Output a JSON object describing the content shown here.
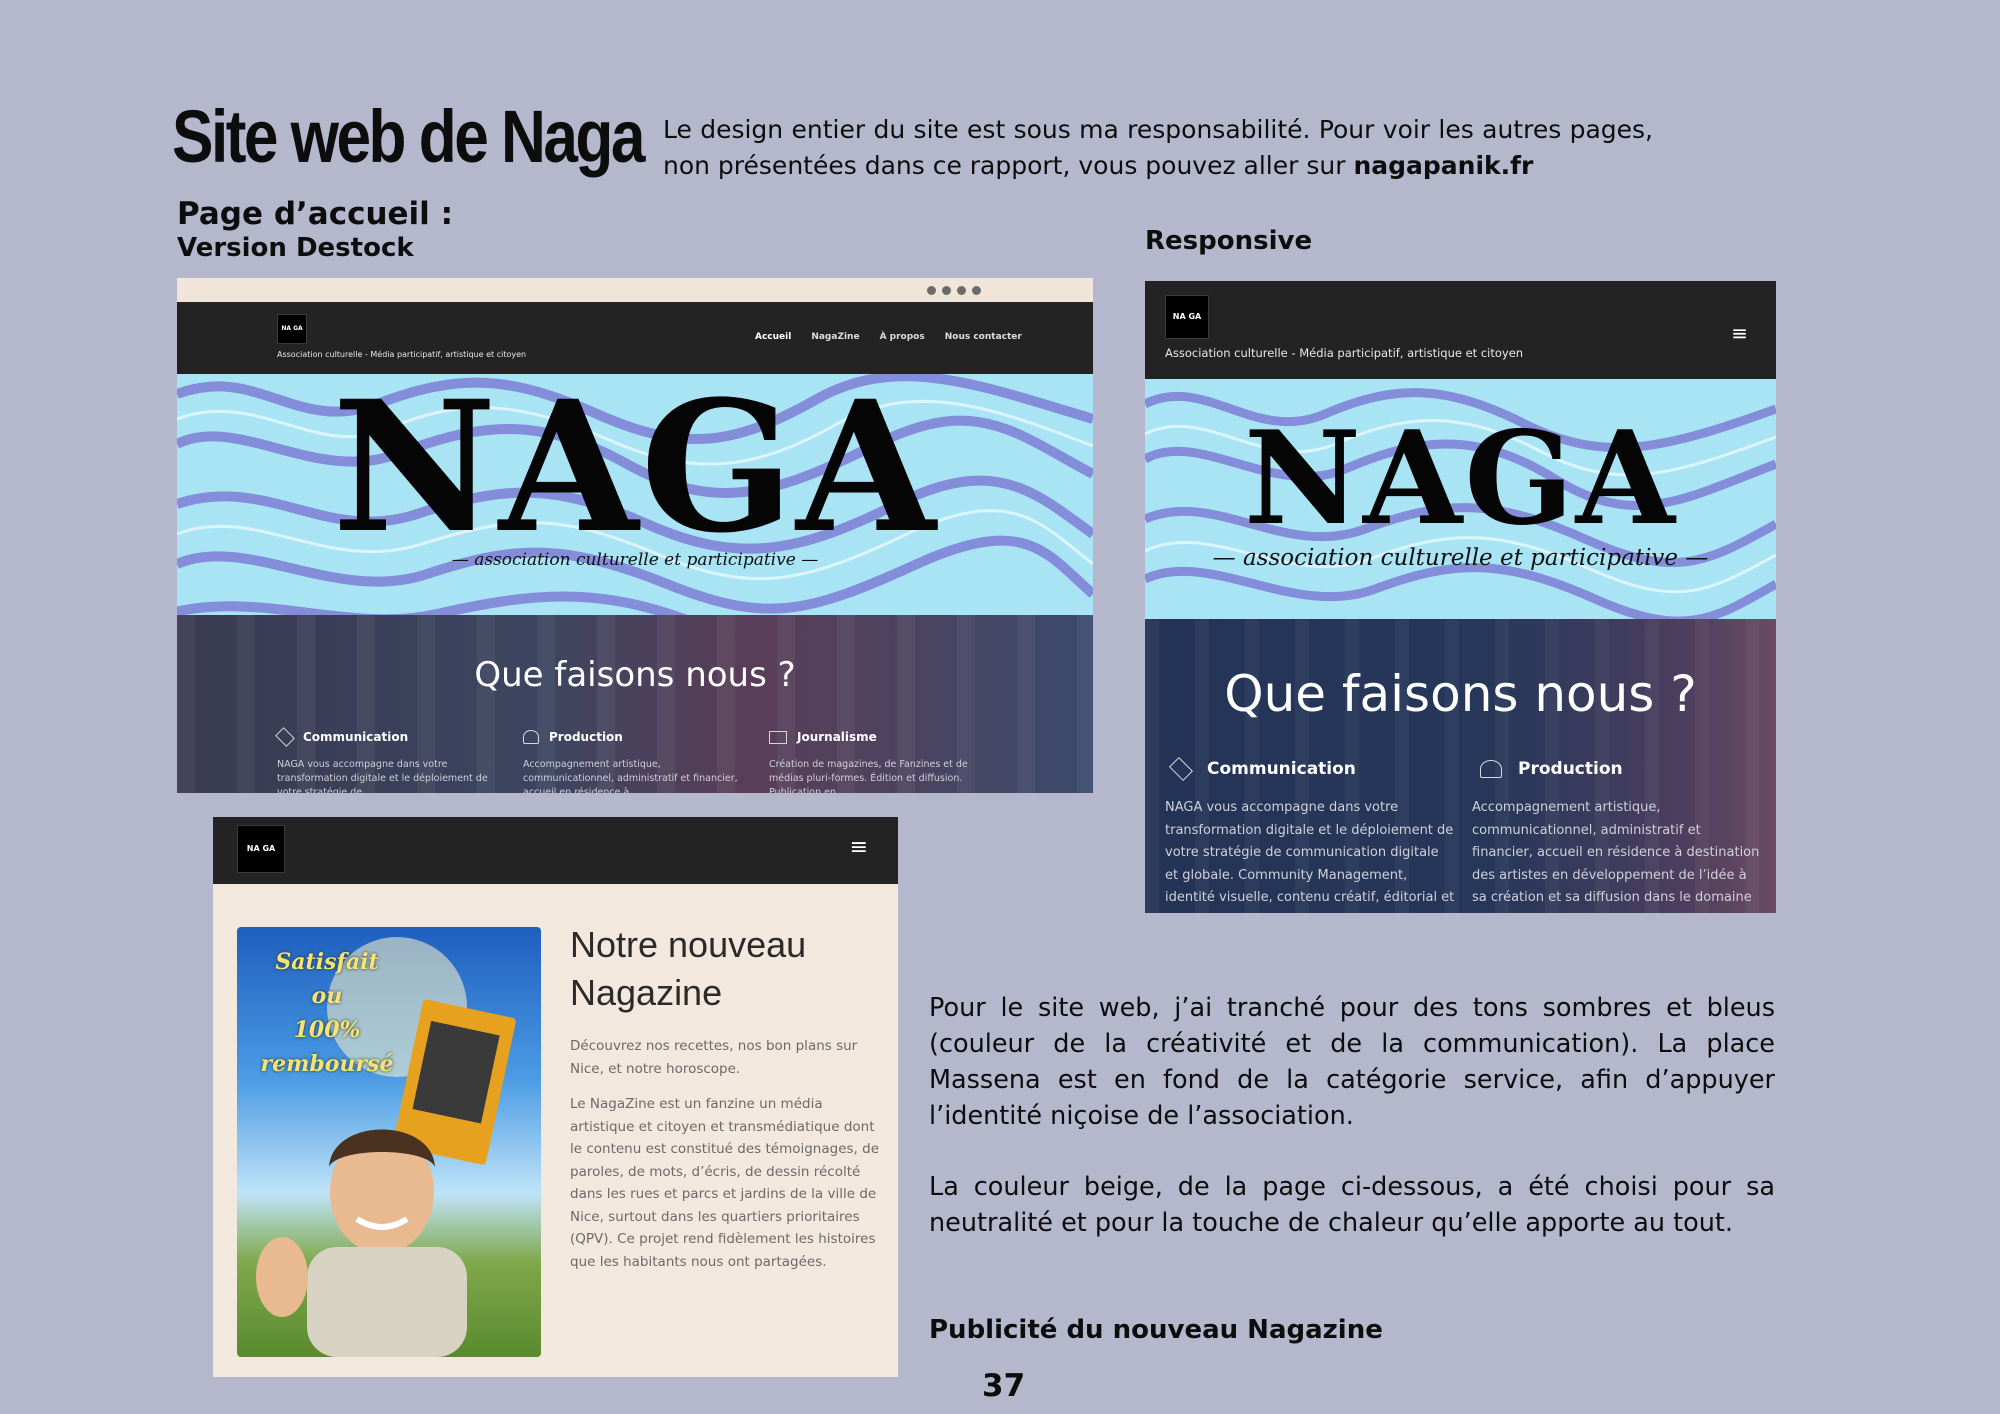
{
  "page": {
    "title": "Site web de Naga",
    "intro_text": "Le design entier du site est sous ma responsabilité. Pour voir les autres pages, non présentées dans ce rapport, vous pouvez aller sur",
    "intro_link": "nagapanik.fr",
    "section_home": "Page d’accueil :",
    "section_desktop": "Version Destock",
    "section_responsive": "Responsive",
    "body_p1": "Pour le site web, j’ai tranché pour des tons sombres et bleus (couleur de la créativité et de la communication). La place Massena est en fond de la catégorie service, afin d’appuyer l’identité niçoise de l’association.",
    "body_p2": "La couleur beige, de la page ci-dessous, a été choisi pour sa neutralité et pour la touche de chaleur qu’elle apporte au tout.",
    "section_ad": "Publicité du nouveau Nagazine",
    "page_number": "37"
  },
  "site": {
    "logo_text": "NA GA",
    "tagline": "Association culturelle - Média participatif, artistique et citoyen",
    "nav": [
      "Accueil",
      "NagaZine",
      "À propos",
      "Nous contacter"
    ],
    "hero_word": "NAGA",
    "hero_sub": "association culturelle et participative",
    "services_title": "Que faisons nous ?",
    "services": [
      {
        "icon": "handshake-icon",
        "title": "Communication",
        "desc_desktop": "NAGA vous accompagne dans votre transformation digitale et le déploiement de votre stratégie de",
        "desc_mobile": "NAGA vous accompagne dans votre transformation digitale et le déploiement de votre stratégie de communication digitale et globale. Community Management, identité visuelle, contenu créatif, éditorial et viral…"
      },
      {
        "icon": "video-camera-icon",
        "title": "Production",
        "desc_desktop": "Accompagnement artistique, communicationnel, administratif et financier, accueil en résidence à",
        "desc_mobile": "Accompagnement artistique, communicationnel, administratif et financier, accueil en résidence à destination des artistes en développement de l’idée à sa création et sa diffusion dans le domaine du"
      },
      {
        "icon": "newspaper-icon",
        "title": "Journalisme",
        "desc_desktop": "Création de magazines, de Fanzines et de médias pluri-formes. Édition et diffusion. Publication en"
      }
    ]
  },
  "magazine": {
    "ad_text_1": "Satisfait ou",
    "ad_text_2": "100%",
    "ad_text_3": "remboursé",
    "heading_1": "Notre nouveau",
    "heading_2": "Nagazine",
    "p1": "Découvrez nos recettes, nos bon plans sur Nice, et notre horoscope.",
    "p2": "Le NagaZine est un fanzine un média artistique et citoyen et transmédiatique dont le contenu est constitué des témoignages, de paroles, de mots, d’écris, de dessin récolté dans les rues et parcs et jardins de la ville de Nice, surtout dans les quartiers prioritaires (QPV). Ce projet rend fidèlement les histoires que les habitants nous ont partagées."
  },
  "colors": {
    "page_bg": "#b5b8cd",
    "navbar": "#232323",
    "beige": "#f3e8dd",
    "hero_bg": "#a9e4f5",
    "hero_swirl": "#7d7fd6",
    "services_overlay": "#243456"
  }
}
